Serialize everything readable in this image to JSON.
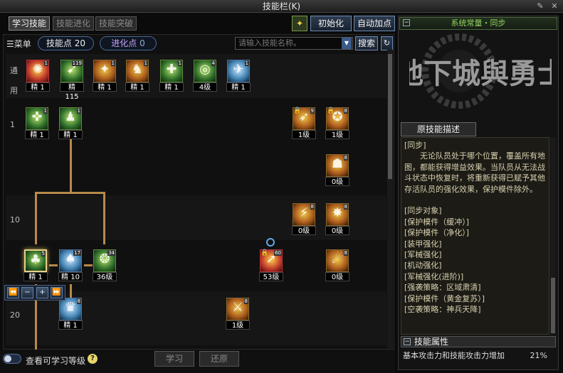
{
  "window": {
    "title": "技能栏(K)"
  },
  "tabs": [
    {
      "label": "学习技能",
      "active": true
    },
    {
      "label": "技能进化",
      "active": false
    },
    {
      "label": "技能突破",
      "active": false
    }
  ],
  "top_buttons": {
    "init": "初始化",
    "auto": "自动加点"
  },
  "menu": {
    "label": "菜单",
    "skill_points_label": "技能点",
    "skill_points": "20",
    "evo_points_label": "进化点",
    "evo_points": "0",
    "search_placeholder": "请输入技能名称。",
    "search_button": "搜索"
  },
  "rows": {
    "common": "通\n用",
    "r1": "1",
    "r10": "10",
    "r20": "20"
  },
  "skills": [
    {
      "name": "s-common-1",
      "badge": "1",
      "slot": "精 1",
      "style": "red",
      "glyph": "✺"
    },
    {
      "name": "s-common-2",
      "badge": "119",
      "slot": "精 115",
      "style": "green",
      "glyph": "➹"
    },
    {
      "name": "s-common-3",
      "badge": "1",
      "slot": "精 1",
      "style": "gold",
      "glyph": "✦"
    },
    {
      "name": "s-common-4",
      "badge": "1",
      "slot": "精 1",
      "style": "gold",
      "glyph": "♞"
    },
    {
      "name": "s-common-5",
      "badge": "1",
      "slot": "精 1",
      "style": "green",
      "glyph": "✚"
    },
    {
      "name": "s-common-6",
      "badge": "4",
      "slot": "4级",
      "style": "green",
      "glyph": "◎"
    },
    {
      "name": "s-common-7",
      "badge": "1",
      "slot": "精 1",
      "style": "blue",
      "glyph": "✈"
    },
    {
      "name": "s-r1-1",
      "badge": "1",
      "slot": "精 1",
      "style": "green",
      "glyph": "✜"
    },
    {
      "name": "s-r1-2",
      "badge": "1",
      "slot": "精 1",
      "style": "green",
      "glyph": "♟"
    },
    {
      "name": "s-r1-3",
      "badge": "9",
      "slot": "1级",
      "style": "gold",
      "glyph": "➶"
    },
    {
      "name": "s-r1-4",
      "badge": "8",
      "slot": "1级",
      "style": "gold",
      "glyph": "✪"
    },
    {
      "name": "s-r5-1",
      "badge": "8",
      "slot": "0级",
      "style": "gold",
      "glyph": "☗"
    },
    {
      "name": "s-r10-1",
      "badge": "8",
      "slot": "0级",
      "style": "gold",
      "glyph": "⚡"
    },
    {
      "name": "s-r10-2",
      "badge": "8",
      "slot": "0级",
      "style": "gold",
      "glyph": "✸"
    },
    {
      "name": "s-r15-1",
      "badge": "5",
      "slot": "精 1",
      "style": "green",
      "glyph": "♣"
    },
    {
      "name": "s-r15-2",
      "badge": "17",
      "slot": "精 10",
      "style": "blue",
      "glyph": "♠"
    },
    {
      "name": "s-r15-3",
      "badge": "34",
      "slot": "36级",
      "style": "green",
      "glyph": "❂"
    },
    {
      "name": "s-r15-4",
      "badge": "60",
      "slot": "53级",
      "style": "red",
      "glyph": "➚"
    },
    {
      "name": "s-r15-5",
      "badge": "8",
      "slot": "0级",
      "style": "gold",
      "glyph": "☄"
    },
    {
      "name": "s-r20-1",
      "badge": "8",
      "slot": "精 1",
      "style": "blue",
      "glyph": "♛"
    },
    {
      "name": "s-r20-2",
      "badge": "8",
      "slot": "1级",
      "style": "gold",
      "glyph": "⚔"
    }
  ],
  "bottom": {
    "toggle_label": "查看可学习等级",
    "learn": "学习",
    "revert": "还原"
  },
  "right": {
    "skill_title": "系统常量・同步",
    "desc_tab": "原技能描述",
    "desc_lines": [
      "[同步]",
      "　　无论队员处于哪个位置，覆盖所有地图，都能获得增益效果。当队员从无法战斗状态中恢复时，将重新获得已赋予其他存活队员的强化效果，保护模件除外。",
      "",
      "[同步对象]",
      "[保护模件（缓冲）]",
      "[保护模件（净化）]",
      "[装甲强化]",
      "[军械强化]",
      "[机动强化]",
      "[军械强化(进阶)]",
      "[强袭策略：区域肃清]",
      "[保护模件（黄金复苏）]",
      "[空袭策略：神兵天降]"
    ],
    "prop_head": "技能属性",
    "prop_label": "基本攻击力和技能攻击力增加",
    "prop_value": "21%"
  }
}
